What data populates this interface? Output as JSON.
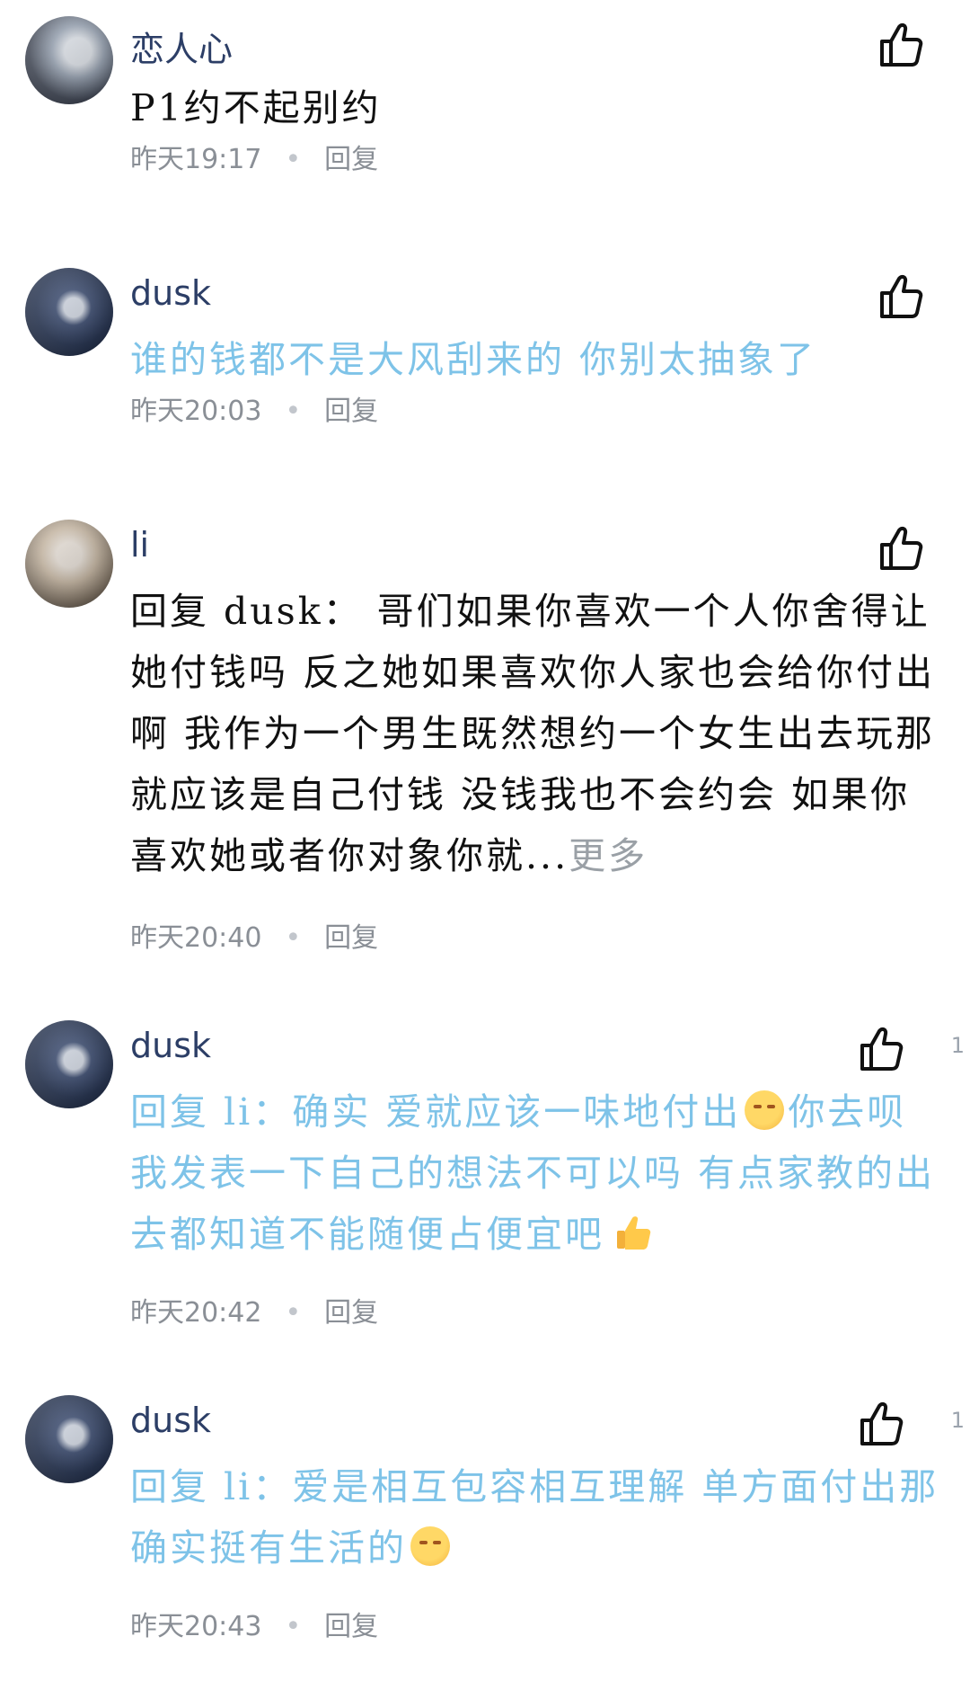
{
  "comments": [
    {
      "username": "恋人心",
      "avatar": "ghostly-figure-avatar",
      "text": "P1约不起别约",
      "time": "昨天19:17",
      "reply_label": "回复"
    },
    {
      "username": "dusk",
      "avatar": "anime-boy-avatar",
      "text": "谁的钱都不是大风刮来的 你别太抽象了",
      "time": "昨天20:03",
      "reply_label": "回复"
    },
    {
      "username": "li",
      "avatar": "cat-photo-avatar",
      "reply_prefix": "回复 dusk：",
      "text": " 哥们如果你喜欢一个人你舍得让她付钱吗 反之她如果喜欢你人家也会给你付出啊 我作为一个男生既然想约一个女生出去玩那就应该是自己付钱 没钱我也不会约会 如果你喜欢她或者你对象你就...",
      "more_label": "更多",
      "time": "昨天20:40",
      "reply_label": "回复"
    },
    {
      "username": "dusk",
      "avatar": "anime-boy-avatar",
      "like_count": "1",
      "reply_prefix": "回复 li：",
      "text_a": "确实 爱就应该一味地付出",
      "text_b": "你去呗 我发表一下自己的想法不可以吗 有点家教的出去都知道不能随便占便宜吧",
      "time": "昨天20:42",
      "reply_label": "回复"
    },
    {
      "username": "dusk",
      "avatar": "anime-boy-avatar",
      "like_count": "1",
      "reply_prefix": "回复 li：",
      "text": "爱是相互包容相互理解 单方面付出那确实挺有生活的",
      "time": "昨天20:43",
      "reply_label": "回复"
    }
  ],
  "colors": {
    "username": "#2c3e66",
    "highlight_text": "#7ec3e8",
    "meta": "#8a8f96"
  }
}
